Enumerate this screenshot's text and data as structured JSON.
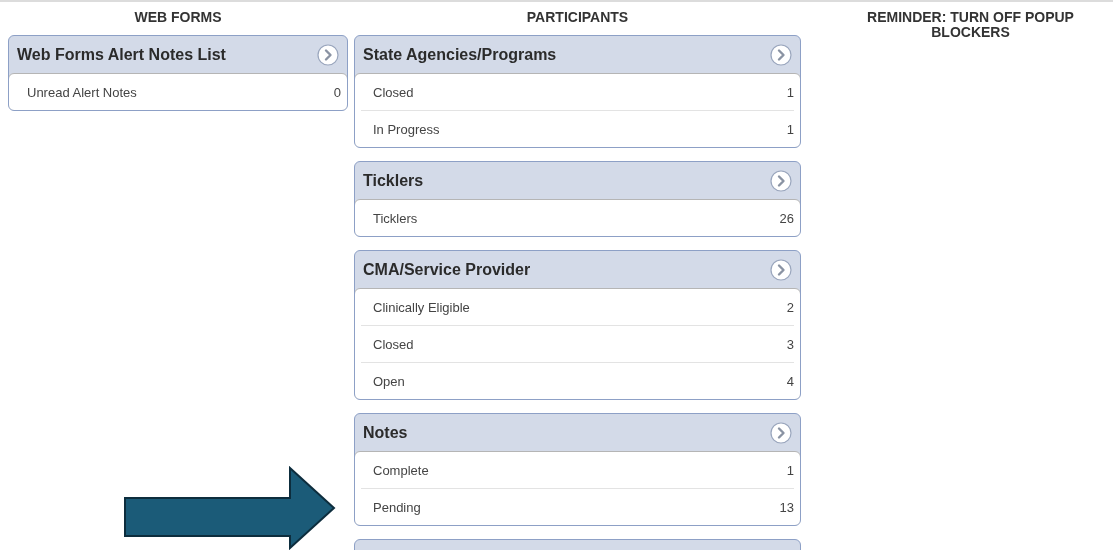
{
  "columns": [
    {
      "heading": "WEB FORMS",
      "cards": [
        {
          "title": "Web Forms Alert Notes List",
          "rows": [
            {
              "label": "Unread Alert Notes",
              "count": "0"
            }
          ]
        }
      ]
    },
    {
      "heading": "PARTICIPANTS",
      "cards": [
        {
          "title": "State Agencies/Programs",
          "rows": [
            {
              "label": "Closed",
              "count": "1"
            },
            {
              "label": "In Progress",
              "count": "1"
            }
          ]
        },
        {
          "title": "Ticklers",
          "rows": [
            {
              "label": "Ticklers",
              "count": "26"
            }
          ]
        },
        {
          "title": "CMA/Service Provider",
          "rows": [
            {
              "label": "Clinically Eligible",
              "count": "2"
            },
            {
              "label": "Closed",
              "count": "3"
            },
            {
              "label": "Open",
              "count": "4"
            }
          ]
        },
        {
          "title": "Notes",
          "rows": [
            {
              "label": "Complete",
              "count": "1"
            },
            {
              "label": "Pending",
              "count": "13"
            }
          ]
        }
      ]
    },
    {
      "heading": "REMINDER: TURN OFF POPUP BLOCKERS"
    }
  ]
}
